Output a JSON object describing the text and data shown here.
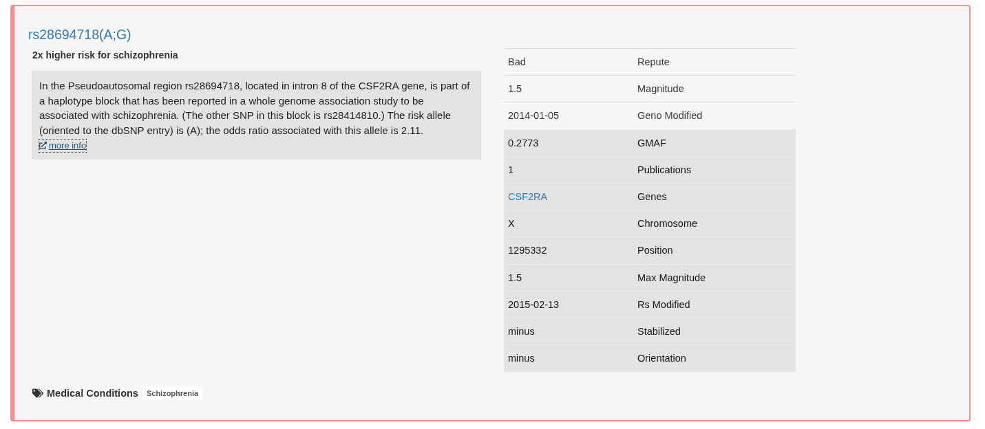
{
  "genotype": {
    "title": "rs28694718(A;G)",
    "summary": "2x higher risk for schizophrenia",
    "description": "In the Pseudoautosomal region rs28694718, located in intron 8 of the CSF2RA gene, is part of a haplotype block that has been reported in a whole genome association study to be associated with schizophrenia. (The other SNP in this block is rs28414810.) The risk allele (oriented to the dbSNP entry) is (A); the odds ratio associated with this allele is 2.11.",
    "more_info": {
      "label": "more info",
      "focused": true
    }
  },
  "table": {
    "rows": [
      {
        "value": "Bad",
        "label": "Repute",
        "shaded": false,
        "kind": "text"
      },
      {
        "value": "1.5",
        "label": "Magnitude",
        "shaded": false,
        "kind": "text"
      },
      {
        "value": "2014-01-05",
        "label": "Geno Modified",
        "shaded": false,
        "kind": "text"
      },
      {
        "value": "0.2773",
        "label": "GMAF",
        "shaded": true,
        "kind": "text"
      },
      {
        "value": "1",
        "label": "Publications",
        "shaded": true,
        "kind": "text"
      },
      {
        "value": "CSF2RA",
        "label": "Genes",
        "shaded": true,
        "kind": "link"
      },
      {
        "value": "X",
        "label": "Chromosome",
        "shaded": true,
        "kind": "text"
      },
      {
        "value": "1295332",
        "label": "Position",
        "shaded": true,
        "kind": "text"
      },
      {
        "value": "1.5",
        "label": "Max Magnitude",
        "shaded": true,
        "kind": "text"
      },
      {
        "value": "2015-02-13",
        "label": "Rs Modified",
        "shaded": true,
        "kind": "text"
      },
      {
        "value": "minus",
        "label": "Stabilized",
        "shaded": true,
        "kind": "text"
      },
      {
        "value": "minus",
        "label": "Orientation",
        "shaded": true,
        "kind": "text"
      }
    ]
  },
  "medical_conditions": {
    "label": "Medical Conditions",
    "tags": [
      "Schizophrenia"
    ]
  }
}
